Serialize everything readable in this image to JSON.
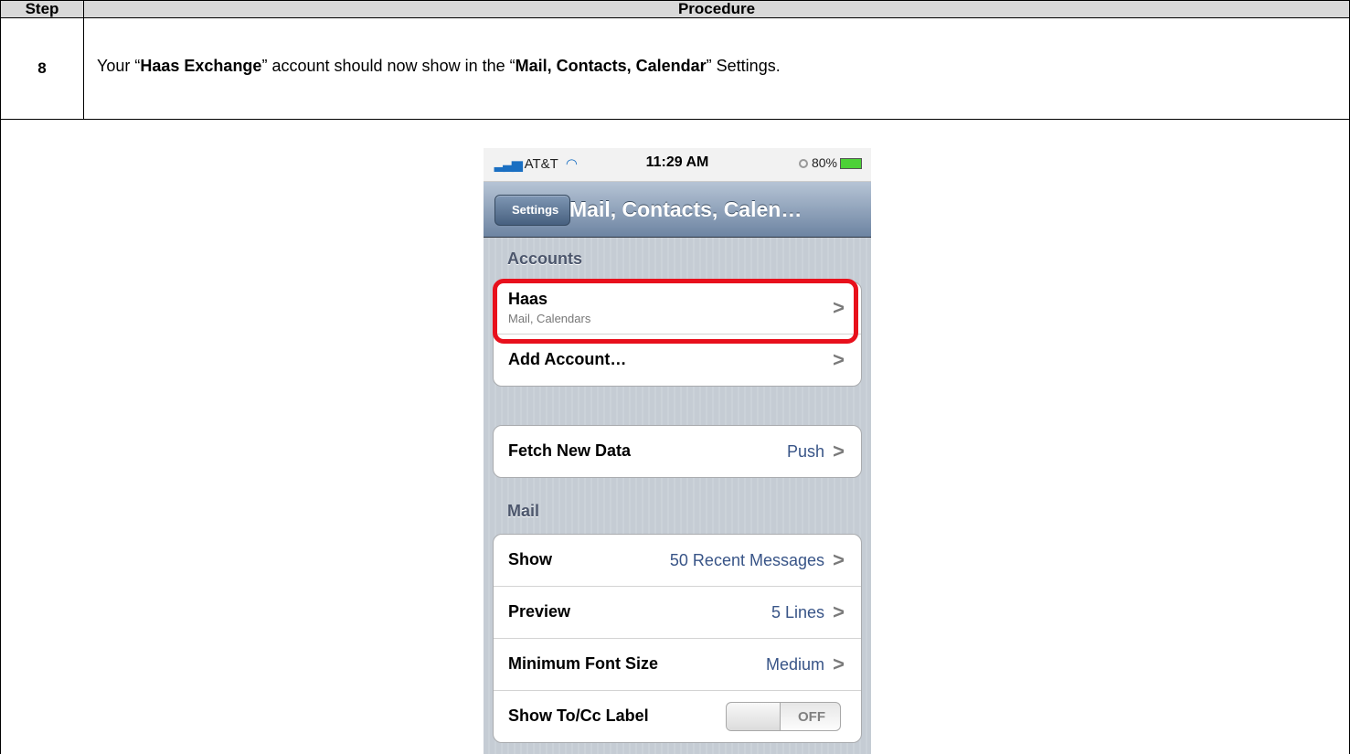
{
  "table": {
    "header_step": "Step",
    "header_procedure": "Procedure",
    "step_number": "8",
    "instruction": {
      "pre": "Your “",
      "account": "Haas Exchange",
      "mid": "” account should now show in the “",
      "settings": "Mail, Contacts, Calendar",
      "post": "” Settings."
    }
  },
  "phone": {
    "status": {
      "carrier": "AT&T",
      "time": "11:29 AM",
      "battery": "80%"
    },
    "nav": {
      "back": "Settings",
      "title": "Mail, Contacts, Calen…"
    },
    "accounts_label": "Accounts",
    "accounts": [
      {
        "label": "Haas",
        "sub": "Mail, Calendars"
      },
      {
        "label": "Add Account…"
      }
    ],
    "fetch": {
      "label": "Fetch New Data",
      "value": "Push"
    },
    "mail_label": "Mail",
    "mail": [
      {
        "label": "Show",
        "value": "50 Recent Messages"
      },
      {
        "label": "Preview",
        "value": "5 Lines"
      },
      {
        "label": "Minimum Font Size",
        "value": "Medium"
      },
      {
        "label": "Show To/Cc Label",
        "toggle": "OFF"
      }
    ],
    "chevron": ">",
    "highlight_color": "#e8101c"
  }
}
